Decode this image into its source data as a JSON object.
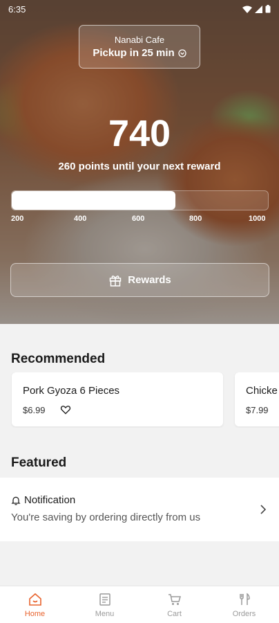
{
  "status_bar": {
    "time": "6:35"
  },
  "pickup": {
    "cafe_name": "Nanabi Cafe",
    "pickup_text": "Pickup in 25 min"
  },
  "rewards": {
    "points": "740",
    "until_text": "260 points until your next reward",
    "progress_fraction": 0.64,
    "ticks": [
      "200",
      "400",
      "600",
      "800",
      "1000"
    ],
    "button_label": "Rewards"
  },
  "recommended": {
    "title": "Recommended",
    "items": [
      {
        "name": "Pork Gyoza 6 Pieces",
        "price": "$6.99"
      },
      {
        "name": "Chicke",
        "price": "$7.99"
      }
    ]
  },
  "featured": {
    "title": "Featured",
    "notification": {
      "title": "Notification",
      "body": "You're saving by ordering directly from us"
    }
  },
  "nav": {
    "items": [
      {
        "label": "Home",
        "icon": "home-icon",
        "active": true
      },
      {
        "label": "Menu",
        "icon": "menu-icon",
        "active": false
      },
      {
        "label": "Cart",
        "icon": "cart-icon",
        "active": false
      },
      {
        "label": "Orders",
        "icon": "orders-icon",
        "active": false
      }
    ]
  },
  "colors": {
    "accent": "#e8622c",
    "muted": "#9a9a9a"
  }
}
